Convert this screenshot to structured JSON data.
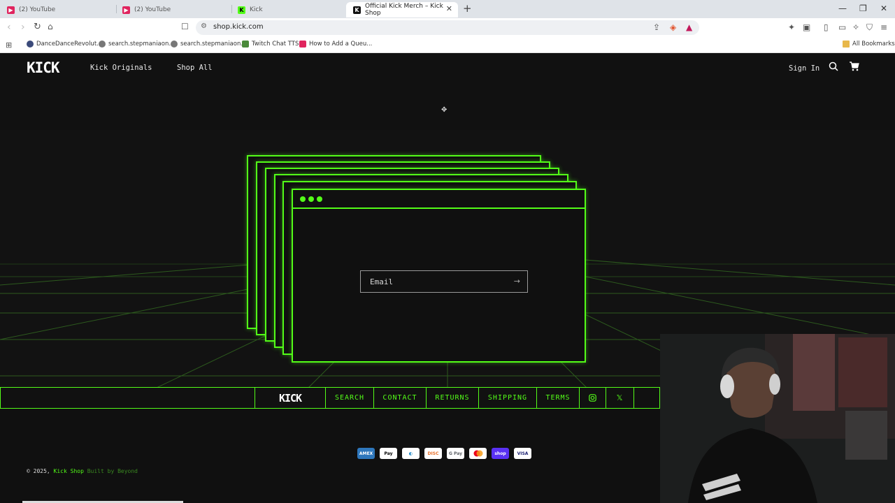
{
  "browser": {
    "tabs": [
      {
        "title": "(2) YouTube",
        "favicon": "youtube-icon"
      },
      {
        "title": "(2) YouTube",
        "favicon": "youtube-icon"
      },
      {
        "title": "Kick",
        "favicon": "kick-icon"
      },
      {
        "title": "Official Kick Merch – Kick Shop",
        "favicon": "kick-icon",
        "active": true
      }
    ],
    "url": "shop.kick.com",
    "bookmarks": [
      {
        "label": "DanceDanceRevolut...",
        "icon": "globe-icon"
      },
      {
        "label": "search.stepmaniaon...",
        "icon": "globe-icon"
      },
      {
        "label": "search.stepmaniaon...",
        "icon": "globe-icon"
      },
      {
        "label": "Twitch Chat TTS",
        "icon": "chat-icon"
      },
      {
        "label": "How to Add a Queu...",
        "icon": "youtube-icon"
      }
    ],
    "all_bookmarks": "All Bookmarks"
  },
  "site": {
    "logo": "KICK",
    "nav": [
      "Kick Originals",
      "Shop All"
    ],
    "sign_in": "Sign In",
    "email_placeholder": "Email",
    "footer_logo": "KICK",
    "footer_links": [
      "SEARCH",
      "CONTACT",
      "RETURNS",
      "SHIPPING",
      "TERMS"
    ],
    "payment_methods": [
      "American Express",
      "Apple Pay",
      "Diners Club",
      "Discover",
      "Google Pay",
      "Mastercard",
      "Shop Pay",
      "Visa"
    ],
    "copyright_prefix": "© 2025,",
    "copyright_store": "Kick Shop",
    "copyright_suffix": "Built by Beyond"
  },
  "colors": {
    "accent": "#53fc18",
    "background": "#101010"
  }
}
